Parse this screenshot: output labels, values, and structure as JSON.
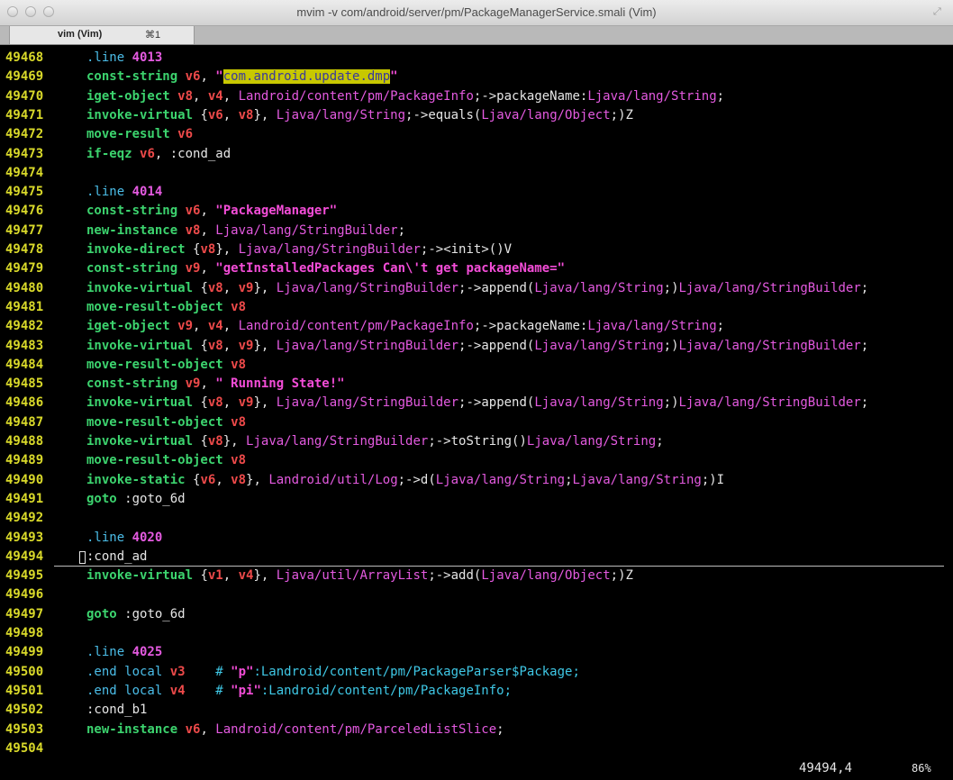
{
  "window": {
    "title": "mvim -v com/android/server/pm/PackageManagerService.smali (Vim)",
    "tab_label": "vim (Vim)",
    "tab_shortcut": "⌘1"
  },
  "status": {
    "position": "49494,4",
    "percent": "86%"
  },
  "colors": {
    "linenr": "#d9d92a",
    "keyword": "#3cd36e",
    "directive": "#4bbde8",
    "number": "#e45ae0",
    "register": "#ee4a4a",
    "string": "#f44dd8",
    "comment": "#3fc8e6",
    "search_highlight": "#c8c800"
  },
  "lines": [
    {
      "n": "49468",
      "t": [
        {
          "c": "dir",
          "s": ".line "
        },
        {
          "c": "num",
          "s": "4013"
        }
      ]
    },
    {
      "n": "49469",
      "t": [
        {
          "c": "kw",
          "s": "const-string "
        },
        {
          "c": "reg",
          "s": "v6"
        },
        {
          "c": "plain",
          "s": ", "
        },
        {
          "c": "str",
          "s": "\""
        },
        {
          "c": "hl",
          "s": "com.android.update.dmp"
        },
        {
          "c": "str",
          "s": "\""
        }
      ]
    },
    {
      "n": "49470",
      "t": [
        {
          "c": "kw",
          "s": "iget-object "
        },
        {
          "c": "reg",
          "s": "v8"
        },
        {
          "c": "plain",
          "s": ", "
        },
        {
          "c": "reg",
          "s": "v4"
        },
        {
          "c": "plain",
          "s": ", "
        },
        {
          "c": "type",
          "s": "Landroid/content/pm/PackageInfo"
        },
        {
          "c": "plain",
          "s": ";->packageName:"
        },
        {
          "c": "type",
          "s": "Ljava/lang/String"
        },
        {
          "c": "plain",
          "s": ";"
        }
      ]
    },
    {
      "n": "49471",
      "t": [
        {
          "c": "kw",
          "s": "invoke-virtual "
        },
        {
          "c": "plain",
          "s": "{"
        },
        {
          "c": "reg",
          "s": "v6"
        },
        {
          "c": "plain",
          "s": ", "
        },
        {
          "c": "reg",
          "s": "v8"
        },
        {
          "c": "plain",
          "s": "}, "
        },
        {
          "c": "type",
          "s": "Ljava/lang/String"
        },
        {
          "c": "plain",
          "s": ";->equals("
        },
        {
          "c": "type",
          "s": "Ljava/lang/Object"
        },
        {
          "c": "plain",
          "s": ";)Z"
        }
      ]
    },
    {
      "n": "49472",
      "t": [
        {
          "c": "kw",
          "s": "move-result "
        },
        {
          "c": "reg",
          "s": "v6"
        }
      ]
    },
    {
      "n": "49473",
      "t": [
        {
          "c": "kw",
          "s": "if-eqz "
        },
        {
          "c": "reg",
          "s": "v6"
        },
        {
          "c": "plain",
          "s": ", :cond_ad"
        }
      ]
    },
    {
      "n": "49474",
      "t": []
    },
    {
      "n": "49475",
      "t": [
        {
          "c": "dir",
          "s": ".line "
        },
        {
          "c": "num",
          "s": "4014"
        }
      ]
    },
    {
      "n": "49476",
      "t": [
        {
          "c": "kw",
          "s": "const-string "
        },
        {
          "c": "reg",
          "s": "v6"
        },
        {
          "c": "plain",
          "s": ", "
        },
        {
          "c": "str",
          "s": "\"PackageManager\""
        }
      ]
    },
    {
      "n": "49477",
      "t": [
        {
          "c": "kw",
          "s": "new-instance "
        },
        {
          "c": "reg",
          "s": "v8"
        },
        {
          "c": "plain",
          "s": ", "
        },
        {
          "c": "type",
          "s": "Ljava/lang/StringBuilder"
        },
        {
          "c": "plain",
          "s": ";"
        }
      ]
    },
    {
      "n": "49478",
      "t": [
        {
          "c": "kw",
          "s": "invoke-direct "
        },
        {
          "c": "plain",
          "s": "{"
        },
        {
          "c": "reg",
          "s": "v8"
        },
        {
          "c": "plain",
          "s": "}, "
        },
        {
          "c": "type",
          "s": "Ljava/lang/StringBuilder"
        },
        {
          "c": "plain",
          "s": ";-><init>()V"
        }
      ]
    },
    {
      "n": "49479",
      "t": [
        {
          "c": "kw",
          "s": "const-string "
        },
        {
          "c": "reg",
          "s": "v9"
        },
        {
          "c": "plain",
          "s": ", "
        },
        {
          "c": "str",
          "s": "\"getInstalledPackages Can\\'t get packageName=\""
        }
      ]
    },
    {
      "n": "49480",
      "t": [
        {
          "c": "kw",
          "s": "invoke-virtual "
        },
        {
          "c": "plain",
          "s": "{"
        },
        {
          "c": "reg",
          "s": "v8"
        },
        {
          "c": "plain",
          "s": ", "
        },
        {
          "c": "reg",
          "s": "v9"
        },
        {
          "c": "plain",
          "s": "}, "
        },
        {
          "c": "type",
          "s": "Ljava/lang/StringBuilder"
        },
        {
          "c": "plain",
          "s": ";->append("
        },
        {
          "c": "type",
          "s": "Ljava/lang/String"
        },
        {
          "c": "plain",
          "s": ";)"
        },
        {
          "c": "type",
          "s": "Ljava/lang/StringBuilder"
        },
        {
          "c": "plain",
          "s": ";"
        }
      ]
    },
    {
      "n": "49481",
      "t": [
        {
          "c": "kw",
          "s": "move-result-object "
        },
        {
          "c": "reg",
          "s": "v8"
        }
      ]
    },
    {
      "n": "49482",
      "t": [
        {
          "c": "kw",
          "s": "iget-object "
        },
        {
          "c": "reg",
          "s": "v9"
        },
        {
          "c": "plain",
          "s": ", "
        },
        {
          "c": "reg",
          "s": "v4"
        },
        {
          "c": "plain",
          "s": ", "
        },
        {
          "c": "type",
          "s": "Landroid/content/pm/PackageInfo"
        },
        {
          "c": "plain",
          "s": ";->packageName:"
        },
        {
          "c": "type",
          "s": "Ljava/lang/String"
        },
        {
          "c": "plain",
          "s": ";"
        }
      ]
    },
    {
      "n": "49483",
      "t": [
        {
          "c": "kw",
          "s": "invoke-virtual "
        },
        {
          "c": "plain",
          "s": "{"
        },
        {
          "c": "reg",
          "s": "v8"
        },
        {
          "c": "plain",
          "s": ", "
        },
        {
          "c": "reg",
          "s": "v9"
        },
        {
          "c": "plain",
          "s": "}, "
        },
        {
          "c": "type",
          "s": "Ljava/lang/StringBuilder"
        },
        {
          "c": "plain",
          "s": ";->append("
        },
        {
          "c": "type",
          "s": "Ljava/lang/String"
        },
        {
          "c": "plain",
          "s": ";)"
        },
        {
          "c": "type",
          "s": "Ljava/lang/StringBuilder"
        },
        {
          "c": "plain",
          "s": ";"
        }
      ]
    },
    {
      "n": "49484",
      "t": [
        {
          "c": "kw",
          "s": "move-result-object "
        },
        {
          "c": "reg",
          "s": "v8"
        }
      ]
    },
    {
      "n": "49485",
      "t": [
        {
          "c": "kw",
          "s": "const-string "
        },
        {
          "c": "reg",
          "s": "v9"
        },
        {
          "c": "plain",
          "s": ", "
        },
        {
          "c": "str",
          "s": "\" Running State!\""
        }
      ]
    },
    {
      "n": "49486",
      "t": [
        {
          "c": "kw",
          "s": "invoke-virtual "
        },
        {
          "c": "plain",
          "s": "{"
        },
        {
          "c": "reg",
          "s": "v8"
        },
        {
          "c": "plain",
          "s": ", "
        },
        {
          "c": "reg",
          "s": "v9"
        },
        {
          "c": "plain",
          "s": "}, "
        },
        {
          "c": "type",
          "s": "Ljava/lang/StringBuilder"
        },
        {
          "c": "plain",
          "s": ";->append("
        },
        {
          "c": "type",
          "s": "Ljava/lang/String"
        },
        {
          "c": "plain",
          "s": ";)"
        },
        {
          "c": "type",
          "s": "Ljava/lang/StringBuilder"
        },
        {
          "c": "plain",
          "s": ";"
        }
      ]
    },
    {
      "n": "49487",
      "t": [
        {
          "c": "kw",
          "s": "move-result-object "
        },
        {
          "c": "reg",
          "s": "v8"
        }
      ]
    },
    {
      "n": "49488",
      "t": [
        {
          "c": "kw",
          "s": "invoke-virtual "
        },
        {
          "c": "plain",
          "s": "{"
        },
        {
          "c": "reg",
          "s": "v8"
        },
        {
          "c": "plain",
          "s": "}, "
        },
        {
          "c": "type",
          "s": "Ljava/lang/StringBuilder"
        },
        {
          "c": "plain",
          "s": ";->toString()"
        },
        {
          "c": "type",
          "s": "Ljava/lang/String"
        },
        {
          "c": "plain",
          "s": ";"
        }
      ]
    },
    {
      "n": "49489",
      "t": [
        {
          "c": "kw",
          "s": "move-result-object "
        },
        {
          "c": "reg",
          "s": "v8"
        }
      ]
    },
    {
      "n": "49490",
      "t": [
        {
          "c": "kw",
          "s": "invoke-static "
        },
        {
          "c": "plain",
          "s": "{"
        },
        {
          "c": "reg",
          "s": "v6"
        },
        {
          "c": "plain",
          "s": ", "
        },
        {
          "c": "reg",
          "s": "v8"
        },
        {
          "c": "plain",
          "s": "}, "
        },
        {
          "c": "type",
          "s": "Landroid/util/Log"
        },
        {
          "c": "plain",
          "s": ";->d("
        },
        {
          "c": "type",
          "s": "Ljava/lang/String"
        },
        {
          "c": "plain",
          "s": ";"
        },
        {
          "c": "type",
          "s": "Ljava/lang/String"
        },
        {
          "c": "plain",
          "s": ";)I"
        }
      ]
    },
    {
      "n": "49491",
      "t": [
        {
          "c": "kw",
          "s": "goto "
        },
        {
          "c": "plain",
          "s": ":goto_6d"
        }
      ]
    },
    {
      "n": "49492",
      "t": []
    },
    {
      "n": "49493",
      "t": [
        {
          "c": "dir",
          "s": ".line "
        },
        {
          "c": "num",
          "s": "4020"
        }
      ]
    },
    {
      "n": "49494",
      "t": [
        {
          "c": "plain",
          "s": ":cond_ad"
        }
      ]
    },
    {
      "n": "49495",
      "t": [
        {
          "c": "kw",
          "s": "invoke-virtual "
        },
        {
          "c": "plain",
          "s": "{"
        },
        {
          "c": "reg",
          "s": "v1"
        },
        {
          "c": "plain",
          "s": ", "
        },
        {
          "c": "reg",
          "s": "v4"
        },
        {
          "c": "plain",
          "s": "}, "
        },
        {
          "c": "type",
          "s": "Ljava/util/ArrayList"
        },
        {
          "c": "plain",
          "s": ";->add("
        },
        {
          "c": "type",
          "s": "Ljava/lang/Object"
        },
        {
          "c": "plain",
          "s": ";)Z"
        }
      ]
    },
    {
      "n": "49496",
      "t": []
    },
    {
      "n": "49497",
      "t": [
        {
          "c": "kw",
          "s": "goto "
        },
        {
          "c": "plain",
          "s": ":goto_6d"
        }
      ]
    },
    {
      "n": "49498",
      "t": []
    },
    {
      "n": "49499",
      "t": [
        {
          "c": "dir",
          "s": ".line "
        },
        {
          "c": "num",
          "s": "4025"
        }
      ]
    },
    {
      "n": "49500",
      "t": [
        {
          "c": "dir",
          "s": ".end local "
        },
        {
          "c": "reg",
          "s": "v3"
        },
        {
          "c": "plain",
          "s": "    "
        },
        {
          "c": "com",
          "s": "# "
        },
        {
          "c": "str",
          "s": "\"p\""
        },
        {
          "c": "com",
          "s": ":Landroid/content/pm/PackageParser$Package;"
        }
      ]
    },
    {
      "n": "49501",
      "t": [
        {
          "c": "dir",
          "s": ".end local "
        },
        {
          "c": "reg",
          "s": "v4"
        },
        {
          "c": "plain",
          "s": "    "
        },
        {
          "c": "com",
          "s": "# "
        },
        {
          "c": "str",
          "s": "\"pi\""
        },
        {
          "c": "com",
          "s": ":Landroid/content/pm/PackageInfo;"
        }
      ]
    },
    {
      "n": "49502",
      "t": [
        {
          "c": "plain",
          "s": ":cond_b1"
        }
      ]
    },
    {
      "n": "49503",
      "t": [
        {
          "c": "kw",
          "s": "new-instance "
        },
        {
          "c": "reg",
          "s": "v6"
        },
        {
          "c": "plain",
          "s": ", "
        },
        {
          "c": "type",
          "s": "Landroid/content/pm/ParceledListSlice"
        },
        {
          "c": "plain",
          "s": ";"
        }
      ]
    },
    {
      "n": "49504",
      "t": []
    }
  ]
}
